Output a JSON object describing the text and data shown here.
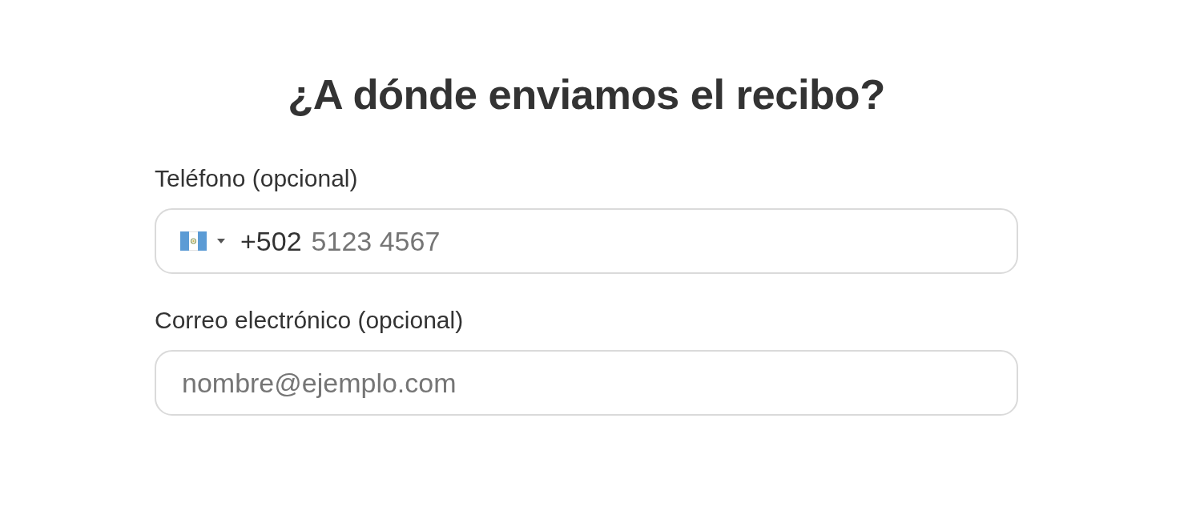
{
  "heading": "¿A dónde enviamos el recibo?",
  "phone": {
    "label": "Teléfono (opcional)",
    "country_code": "+502",
    "placeholder": "5123 4567"
  },
  "email": {
    "label": "Correo electrónico (opcional)",
    "placeholder": "nombre@ejemplo.com"
  }
}
